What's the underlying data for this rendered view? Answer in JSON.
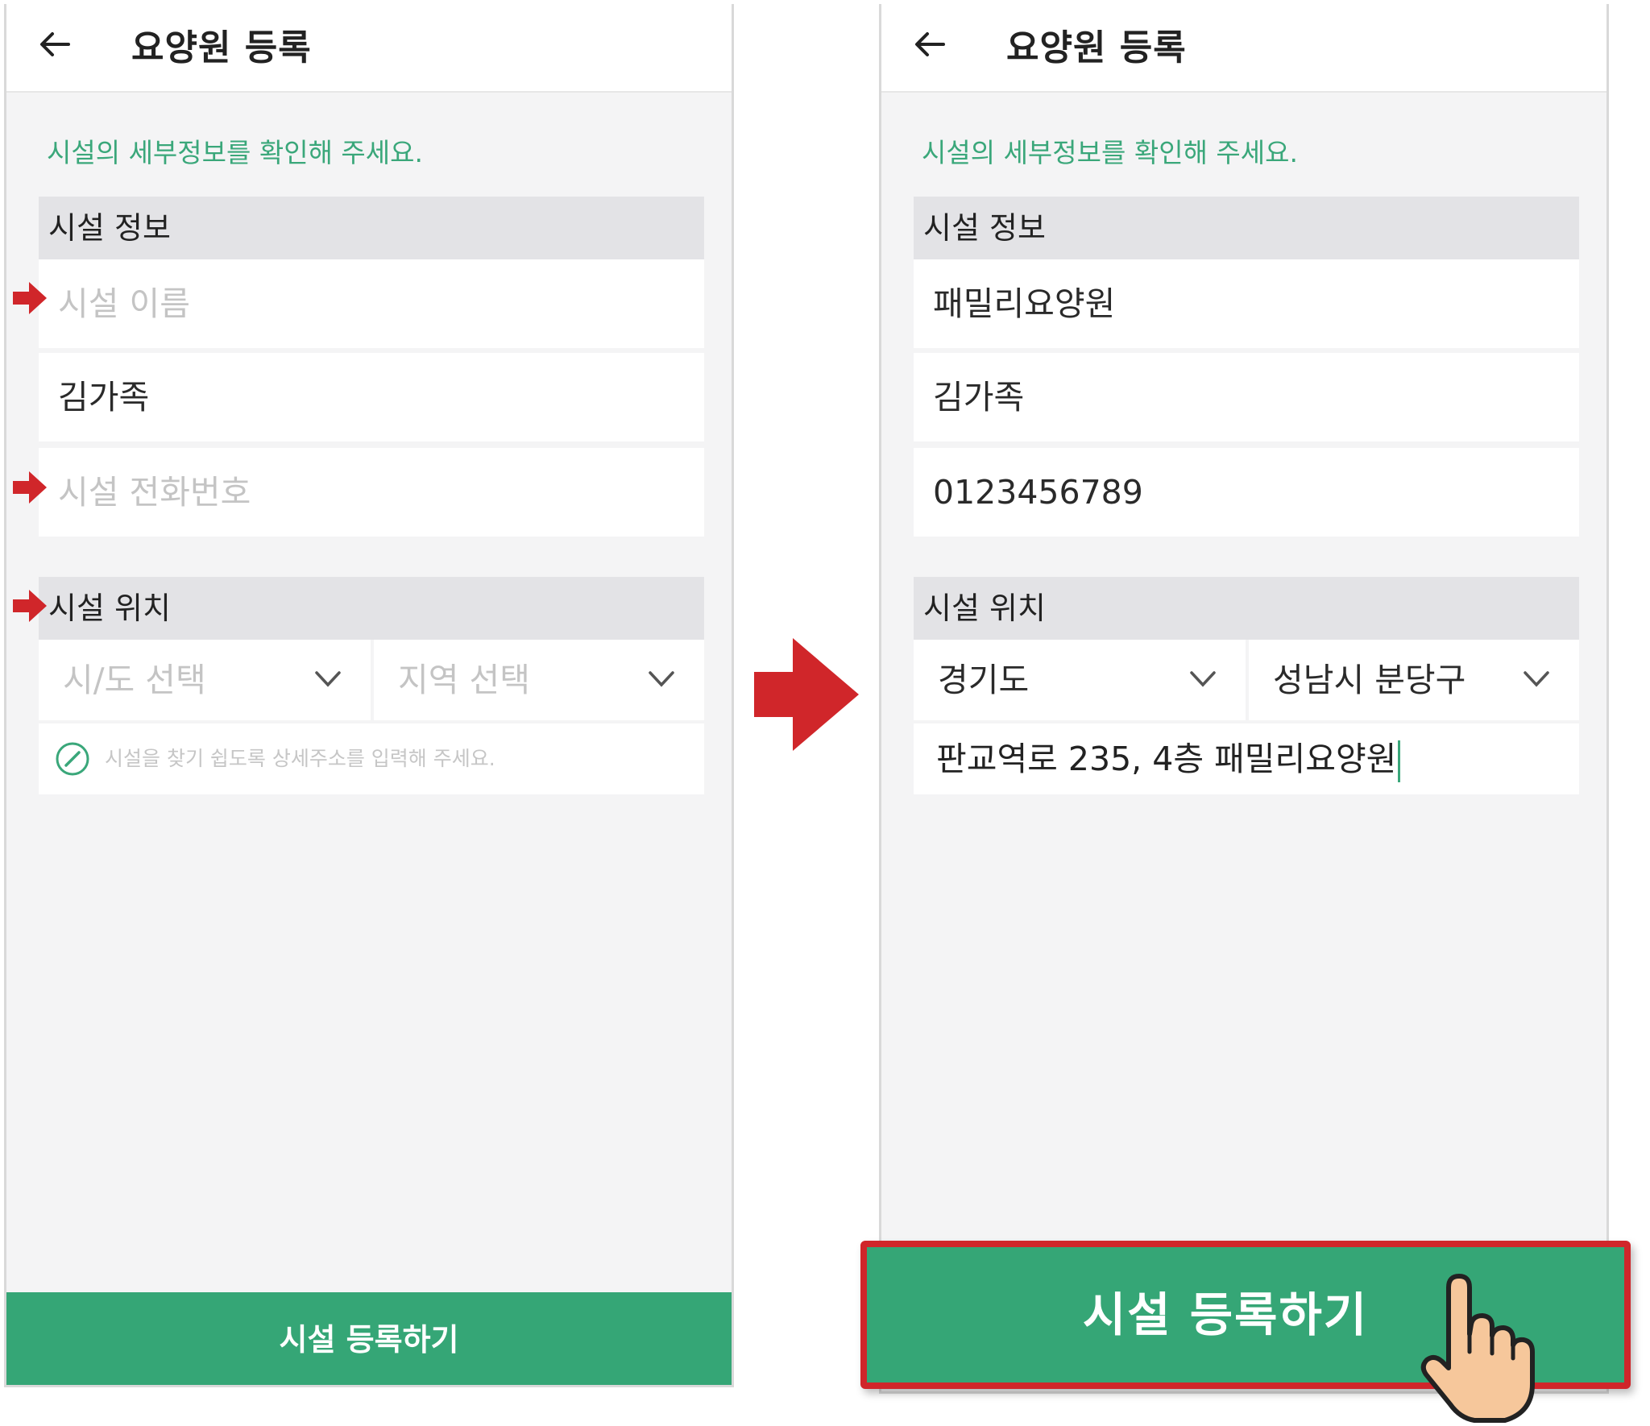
{
  "left": {
    "header": {
      "title": "요양원 등록"
    },
    "instruction": "시설의 세부정보를 확인해 주세요.",
    "facility_info": {
      "section_title": "시설 정보",
      "name_placeholder": "시설 이름",
      "representative_value": "김가족",
      "phone_placeholder": "시설 전화번호"
    },
    "facility_location": {
      "section_title": "시설 위치",
      "province_placeholder": "시/도 선택",
      "region_placeholder": "지역 선택",
      "address_hint": "시설을 찾기 쉽도록 상세주소를 입력해 주세요."
    },
    "submit_label": "시설 등록하기"
  },
  "right": {
    "header": {
      "title": "요양원 등록"
    },
    "instruction": "시설의 세부정보를 확인해 주세요.",
    "facility_info": {
      "section_title": "시설 정보",
      "name_value": "패밀리요양원",
      "representative_value": "김가족",
      "phone_value": "0123456789"
    },
    "facility_location": {
      "section_title": "시설 위치",
      "province_value": "경기도",
      "region_value": "성남시 분당구",
      "address_value": "판교역로 235, 4층 패밀리요양원"
    },
    "submit_label": "시설 등록하기"
  },
  "colors": {
    "accent_green": "#35a676",
    "instruction_green": "#3aa77a",
    "annotation_red": "#d0262a"
  }
}
